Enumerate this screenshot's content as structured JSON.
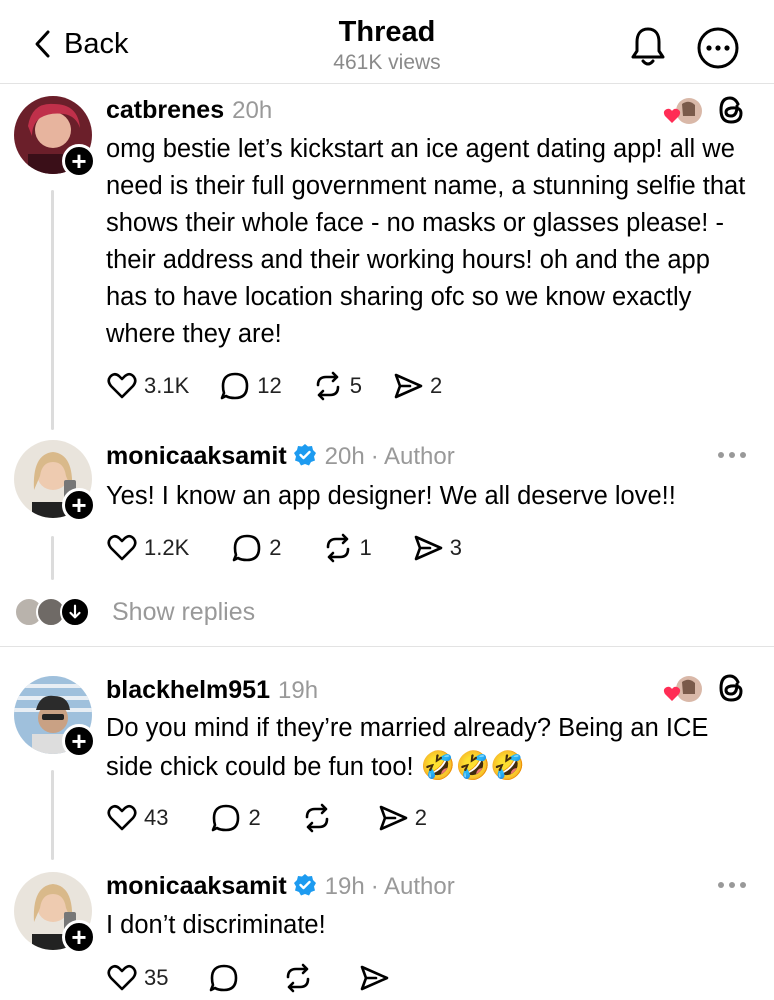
{
  "header": {
    "back_label": "Back",
    "title": "Thread",
    "views": "461K views",
    "icons": [
      "chevron-left-icon",
      "bell-icon",
      "more-icon"
    ]
  },
  "posts": [
    {
      "username": "catbrenes",
      "time": "20h",
      "verified": false,
      "author_tag": "",
      "text": "omg bestie let’s kickstart an ice agent dating app! all we need is their full government name, a stunning selfie that shows their whole face - no masks or glasses please! - their address and their working hours! oh and the app has to have location sharing ofc so we know exactly where they are!",
      "likes": "3.1K",
      "replies": "12",
      "reposts": "5",
      "shares": "2"
    },
    {
      "username": "monicaaksamit",
      "time": "20h",
      "verified": true,
      "author_tag": "· Author",
      "text": "Yes! I know an app designer! We all deserve love!!",
      "likes": "1.2K",
      "replies": "2",
      "reposts": "1",
      "shares": "3"
    },
    {
      "username": "blackhelm951",
      "time": "19h",
      "verified": false,
      "author_tag": "",
      "text": "Do you mind if they’re married already? Being an ICE side chick could be fun too!",
      "emoji": "🤣🤣🤣",
      "likes": "43",
      "replies": "2",
      "reposts": "",
      "shares": "2"
    },
    {
      "username": "monicaaksamit",
      "time": "19h",
      "verified": true,
      "author_tag": "· Author",
      "text": "I don’t discriminate!",
      "likes": "35",
      "replies": "",
      "reposts": "",
      "shares": ""
    }
  ],
  "show_replies": {
    "label": "Show replies"
  },
  "colors": {
    "verified_blue": "#1d9bf0",
    "heart_red": "#ff2d55",
    "muted": "#999999"
  }
}
